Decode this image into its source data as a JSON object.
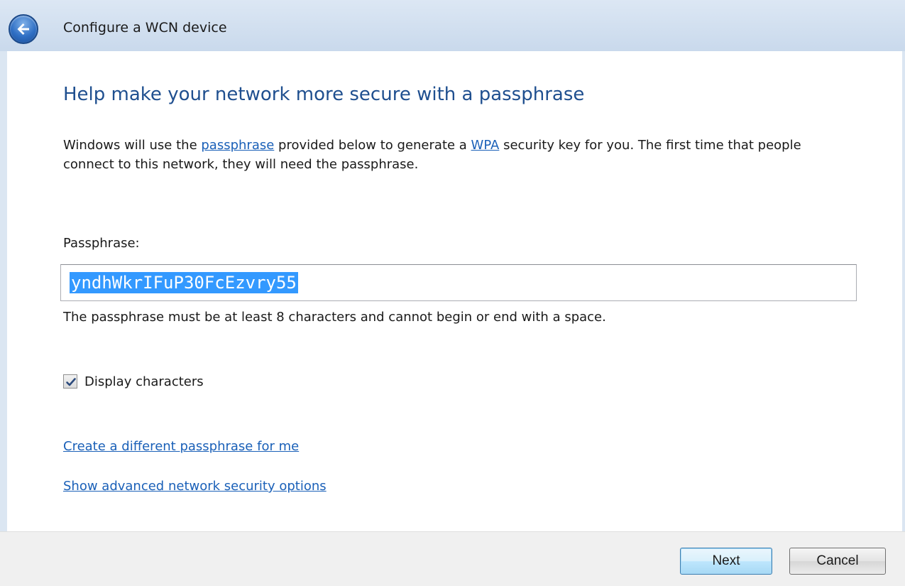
{
  "window": {
    "title": "Configure a WCN device",
    "back_icon": "back-arrow-icon"
  },
  "main": {
    "heading": "Help make your network more secure with a passphrase",
    "description": {
      "part1": "Windows will use the ",
      "link1": "passphrase",
      "part2": " provided below to generate a ",
      "link2": "WPA",
      "part3": " security key for you. The first time that people connect to this network, they will need the passphrase."
    },
    "passphrase": {
      "label": "Passphrase:",
      "value": "yndhWkrIFuP30FcEzvry55",
      "hint": "The passphrase must be at least 8 characters and cannot begin or end with a space."
    },
    "display_characters": {
      "label": "Display characters",
      "checked": true
    },
    "links": {
      "create_different": "Create a different passphrase for me",
      "show_advanced": "Show advanced network security options"
    }
  },
  "footer": {
    "next_label": "Next",
    "cancel_label": "Cancel"
  },
  "colors": {
    "heading": "#1f4f8f",
    "link": "#1a60b8",
    "selection": "#3399ff",
    "title_bar": "#c9d9ec"
  }
}
